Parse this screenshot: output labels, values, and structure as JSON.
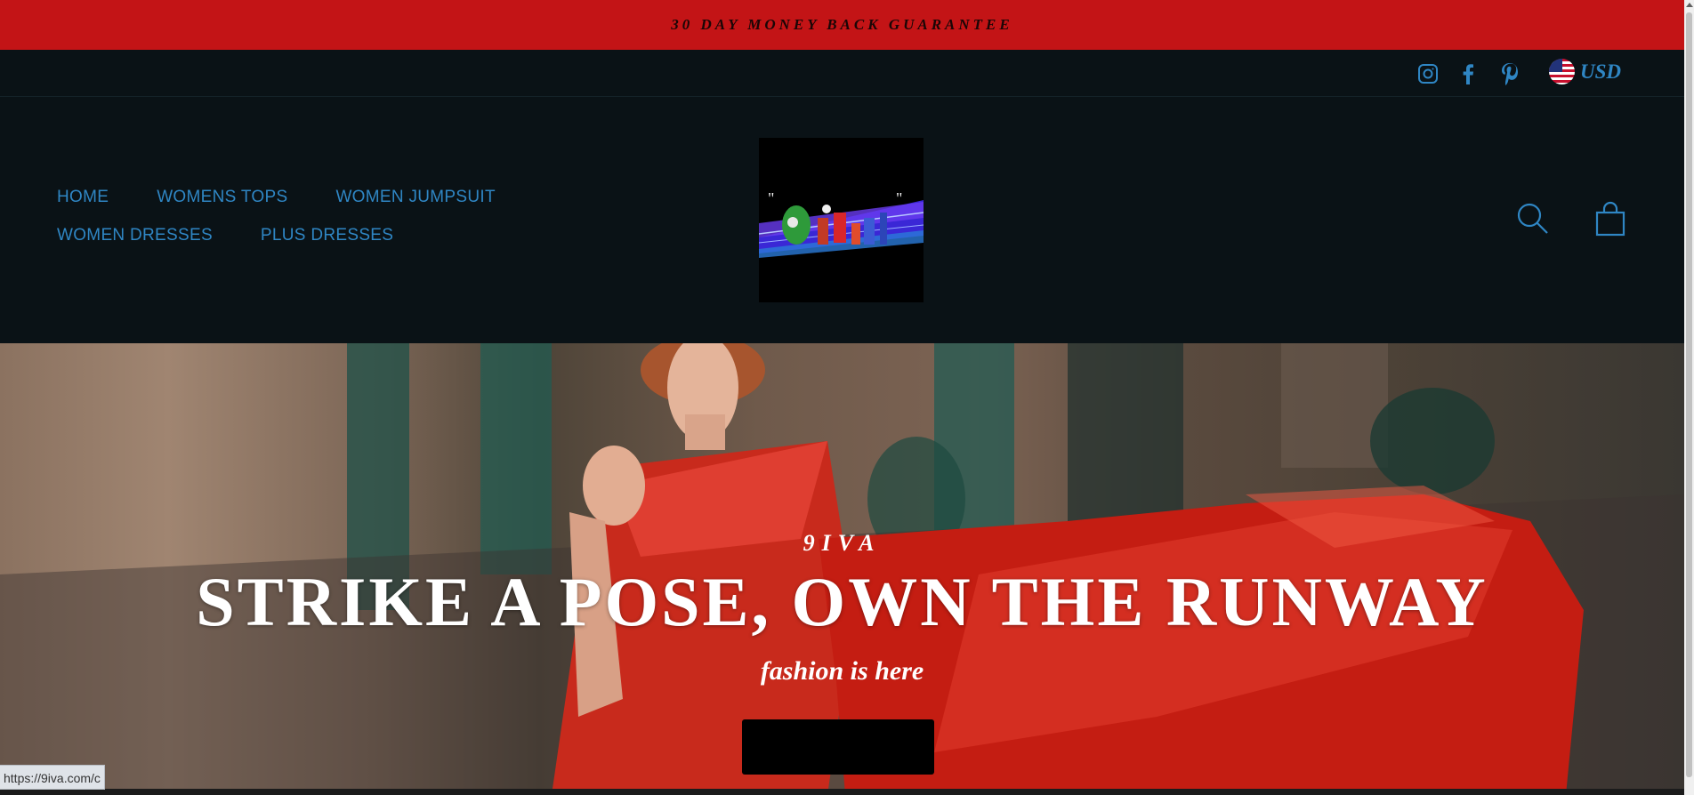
{
  "announcement": {
    "text": "30 DAY MONEY BACK GUARANTEE"
  },
  "utility_bar": {
    "social_icons": [
      "instagram-icon",
      "facebook-icon",
      "pinterest-icon"
    ],
    "currency": {
      "label": "USD",
      "flag_icon": "us-flag-icon"
    }
  },
  "header": {
    "nav": {
      "row1": [
        "HOME",
        "WOMENS TOPS",
        "WOMEN JUMPSUIT"
      ],
      "row2": [
        "WOMEN DRESSES",
        "PLUS DRESSES"
      ]
    },
    "actions": [
      "search-icon",
      "cart-icon"
    ]
  },
  "hero": {
    "eyebrow": "9IVA",
    "title": "STRIKE A POSE, OWN THE RUNWAY",
    "subtitle": "fashion is here",
    "cta_label": ""
  },
  "status_bar": {
    "url": "https://9iva.com/c"
  },
  "colors": {
    "announcement_bg": "#c31416",
    "header_bg": "#0a1216",
    "accent_blue": "#2f86c4",
    "hero_text": "#ffffff"
  }
}
